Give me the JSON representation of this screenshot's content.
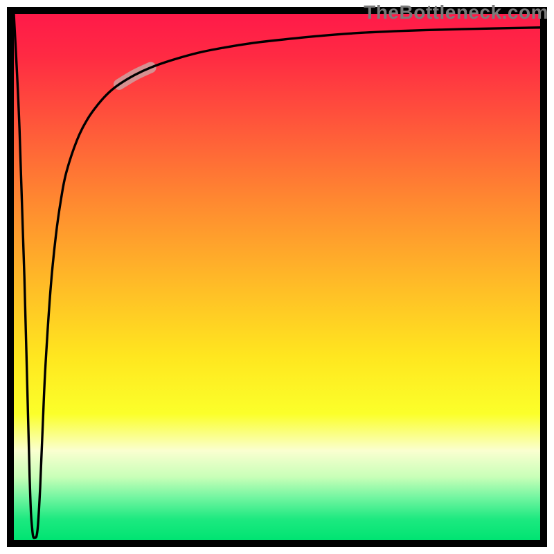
{
  "watermark": "TheBottleneck.com",
  "chart_data": {
    "type": "line",
    "title": "",
    "xlabel": "",
    "ylabel": "",
    "xlim": [
      0,
      100
    ],
    "ylim": [
      0,
      100
    ],
    "grid": false,
    "legend": false,
    "background_gradient": {
      "direction": "vertical",
      "stops": [
        {
          "pos": 0.0,
          "color": "#ff1a49"
        },
        {
          "pos": 0.22,
          "color": "#ff5a3a"
        },
        {
          "pos": 0.5,
          "color": "#ffb728"
        },
        {
          "pos": 0.76,
          "color": "#fbff2a"
        },
        {
          "pos": 0.88,
          "color": "#c8ffb8"
        },
        {
          "pos": 1.0,
          "color": "#00e472"
        }
      ]
    },
    "series": [
      {
        "name": "bottleneck-curve",
        "color": "#000000",
        "stroke_width": 3.4,
        "x": [
          0.0,
          1.0,
          2.0,
          3.0,
          3.5,
          4.0,
          4.5,
          5.0,
          5.5,
          6.0,
          7.0,
          8.0,
          9.0,
          10.0,
          12.0,
          14.0,
          16.0,
          18.0,
          20.0,
          23.0,
          26.0,
          30.0,
          35.0,
          40.0,
          45.0,
          50.0,
          58.0,
          66.0,
          75.0,
          85.0,
          100.0
        ],
        "y": [
          100.0,
          80.0,
          50.0,
          12.0,
          2.0,
          0.5,
          2.0,
          10.0,
          22.0,
          33.0,
          48.0,
          58.0,
          65.0,
          70.0,
          76.0,
          80.0,
          82.8,
          85.0,
          86.6,
          88.4,
          89.8,
          91.2,
          92.6,
          93.6,
          94.4,
          95.0,
          95.8,
          96.4,
          96.8,
          97.1,
          97.4
        ]
      }
    ],
    "highlight_segment": {
      "series": "bottleneck-curve",
      "x_range": [
        20,
        26
      ],
      "color": "#d29a9a",
      "stroke_width": 16
    },
    "annotations": []
  }
}
